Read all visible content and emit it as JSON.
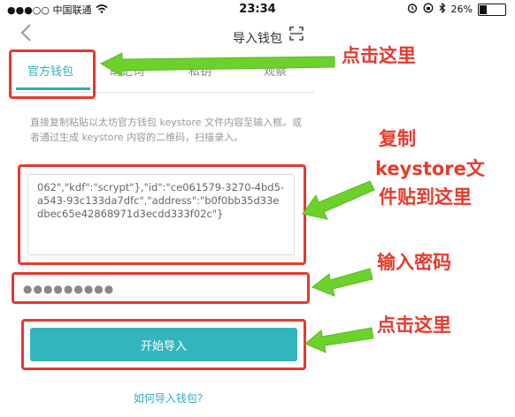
{
  "status_bar": {
    "carrier": "●●●○○ 中国联通",
    "time": "23:34",
    "battery_percent": "26%"
  },
  "nav": {
    "title": "导入钱包",
    "back_icon": "chevron-left-icon",
    "scan_icon": "scan-icon"
  },
  "tabs": [
    {
      "label": "官方钱包",
      "active": true
    },
    {
      "label": "助记词",
      "active": false
    },
    {
      "label": "私钥",
      "active": false
    },
    {
      "label": "观察",
      "active": false
    }
  ],
  "description": "直接复制粘贴以太坊官方钱包 keystore 文件内容至输入框。或者通过生成 keystore 内容的二维码，扫描录入。",
  "keystore": {
    "value": "062\",\"kdf\":\"scrypt\"},\"id\":\"ce061579-3270-4bd5-a543-93c133da7dfc\",\"address\":\"b0f0bb35d33edbec65e42868971d3ecdd333f02c\"}"
  },
  "password": {
    "value": "●●●●●●●●●"
  },
  "import_button": {
    "label": "开始导入"
  },
  "help_link": {
    "label": "如何导入钱包?"
  },
  "annotations": {
    "click_here_1": "点击这里",
    "paste_keystore": [
      "复制",
      "keystore文",
      "件贴到这里"
    ],
    "enter_password": "输入密码",
    "click_here_2": "点击这里"
  },
  "colors": {
    "accent": "#2ab0b8",
    "button": "#33b5bd",
    "annotation_red": "#e8392f",
    "arrow_green": "#6cd12a"
  }
}
